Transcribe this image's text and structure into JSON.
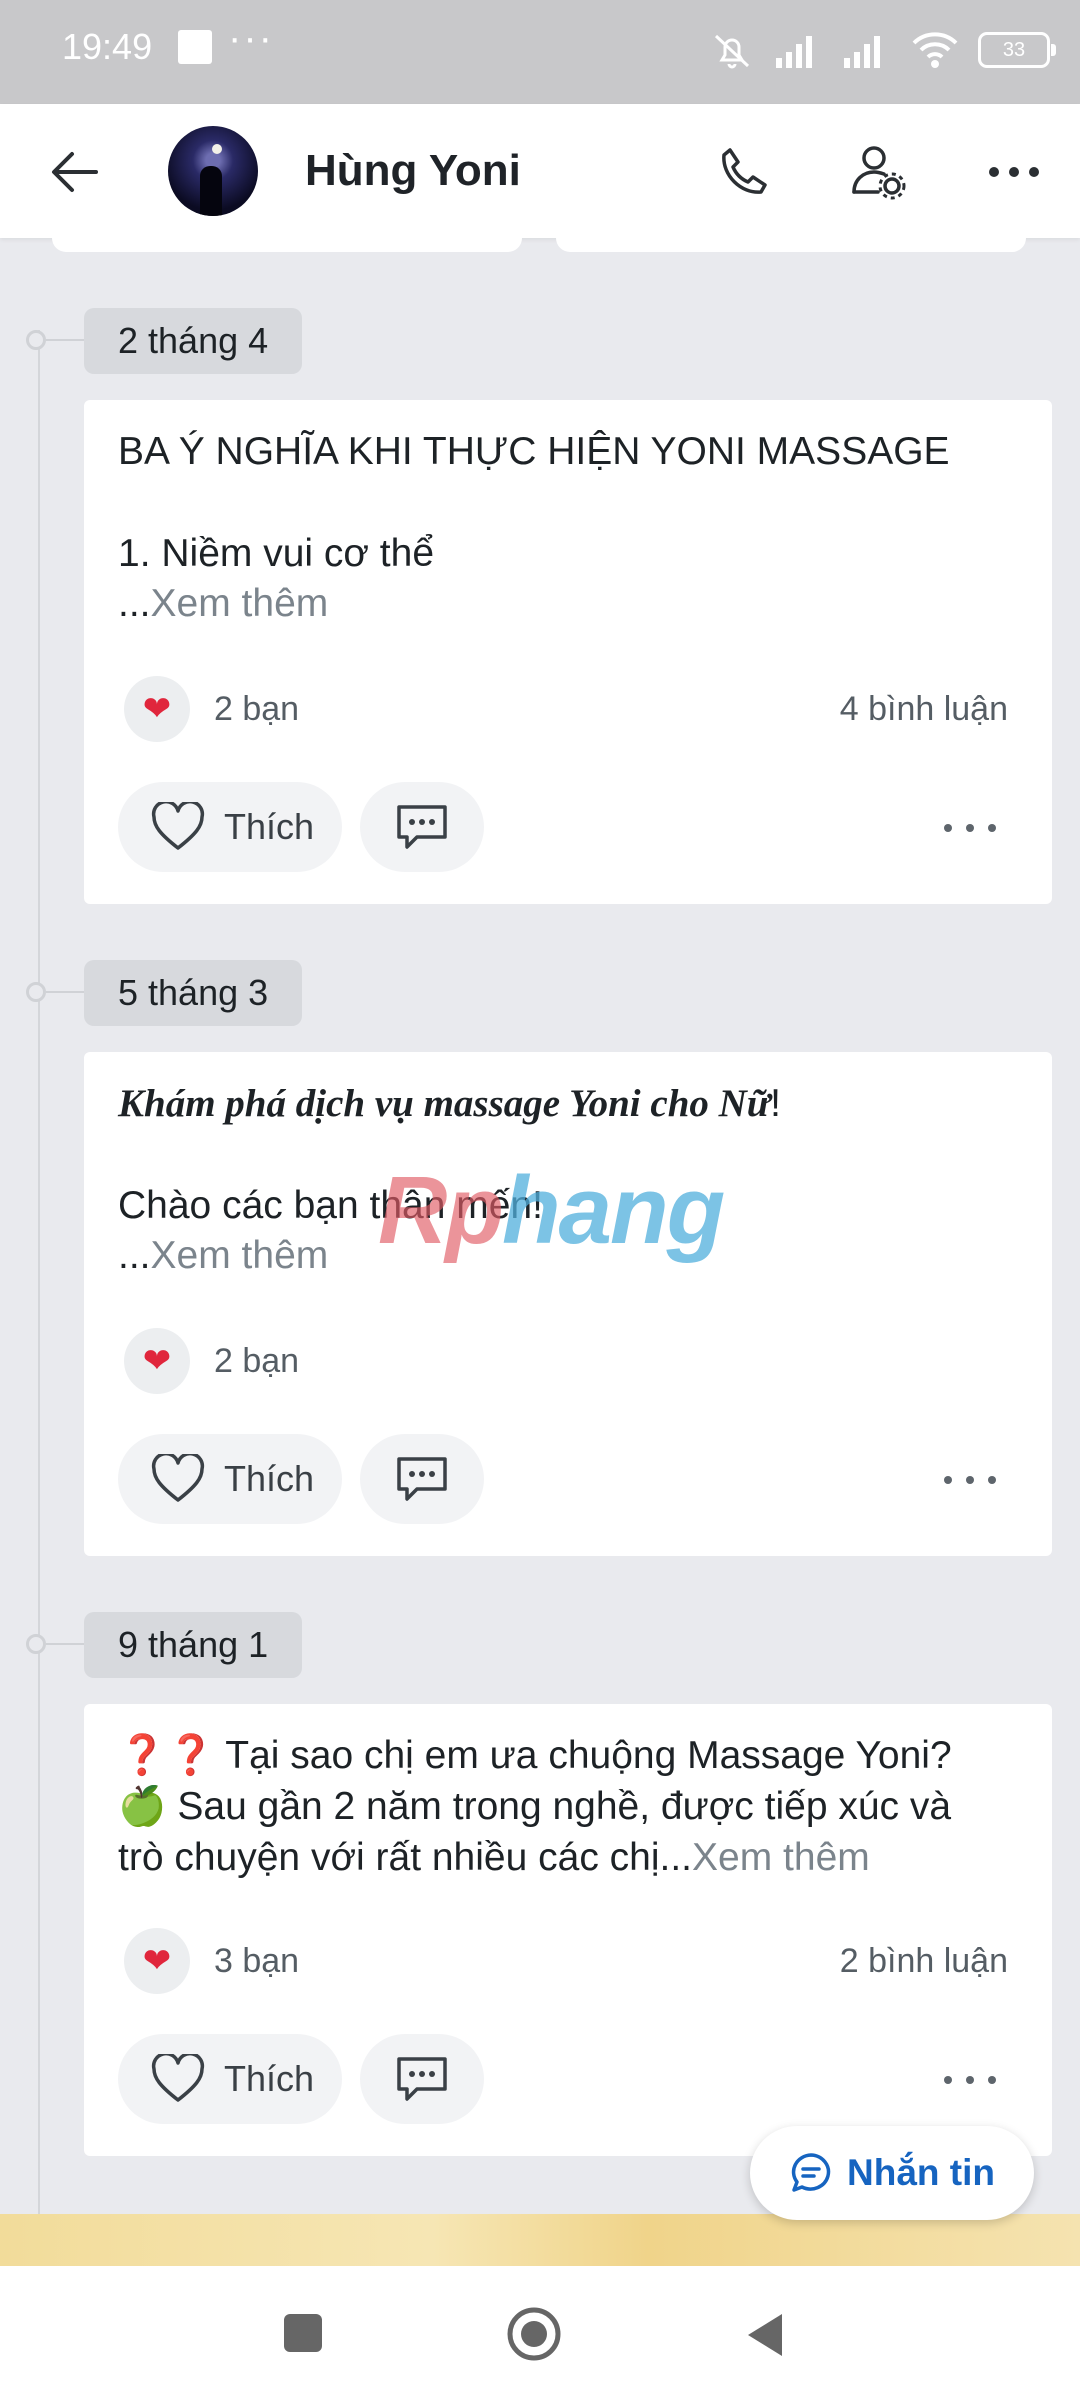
{
  "status_bar": {
    "time": "19:49",
    "battery": "33"
  },
  "header": {
    "contact_name": "Hùng Yoni"
  },
  "posts": [
    {
      "date": "2 tháng 4",
      "text_line1": "BA Ý NGHĨA KHI THỰC HIỆN YONI MASSAGE",
      "text_line2": "1. Niềm vui cơ thể",
      "ellipsis": "...",
      "see_more": "Xem thêm",
      "reactions": "2 bạn",
      "comments": "4 bình luận",
      "like_label": "Thích"
    },
    {
      "date": "5 tháng 3",
      "text_line1": "Khám phá dịch vụ massage Yoni cho Nữ",
      "text_line1_suffix": "!",
      "text_line2": "Chào các bạn thân mến!",
      "ellipsis": "...",
      "see_more": "Xem thêm",
      "reactions": "2 bạn",
      "like_label": "Thích"
    },
    {
      "date": "9 tháng 1",
      "text_line1": "❓❓ Tại sao chị em ưa chuộng Massage Yoni?",
      "text_line2": "🍏 Sau gần 2 năm trong nghề, được tiếp xúc và",
      "text_line3": "trò chuyện với rất nhiều các chị",
      "ellipsis": "...",
      "see_more": "Xem thêm",
      "reactions": "3 bạn",
      "comments": "2 bình luận",
      "like_label": "Thích"
    }
  ],
  "watermark": {
    "part1": "Rp",
    "part2": "hang"
  },
  "message_button": {
    "label": "Nhắn tin"
  },
  "colors": {
    "accent": "#1664c0",
    "heart": "#e0263c",
    "background": "#e9eaee"
  }
}
